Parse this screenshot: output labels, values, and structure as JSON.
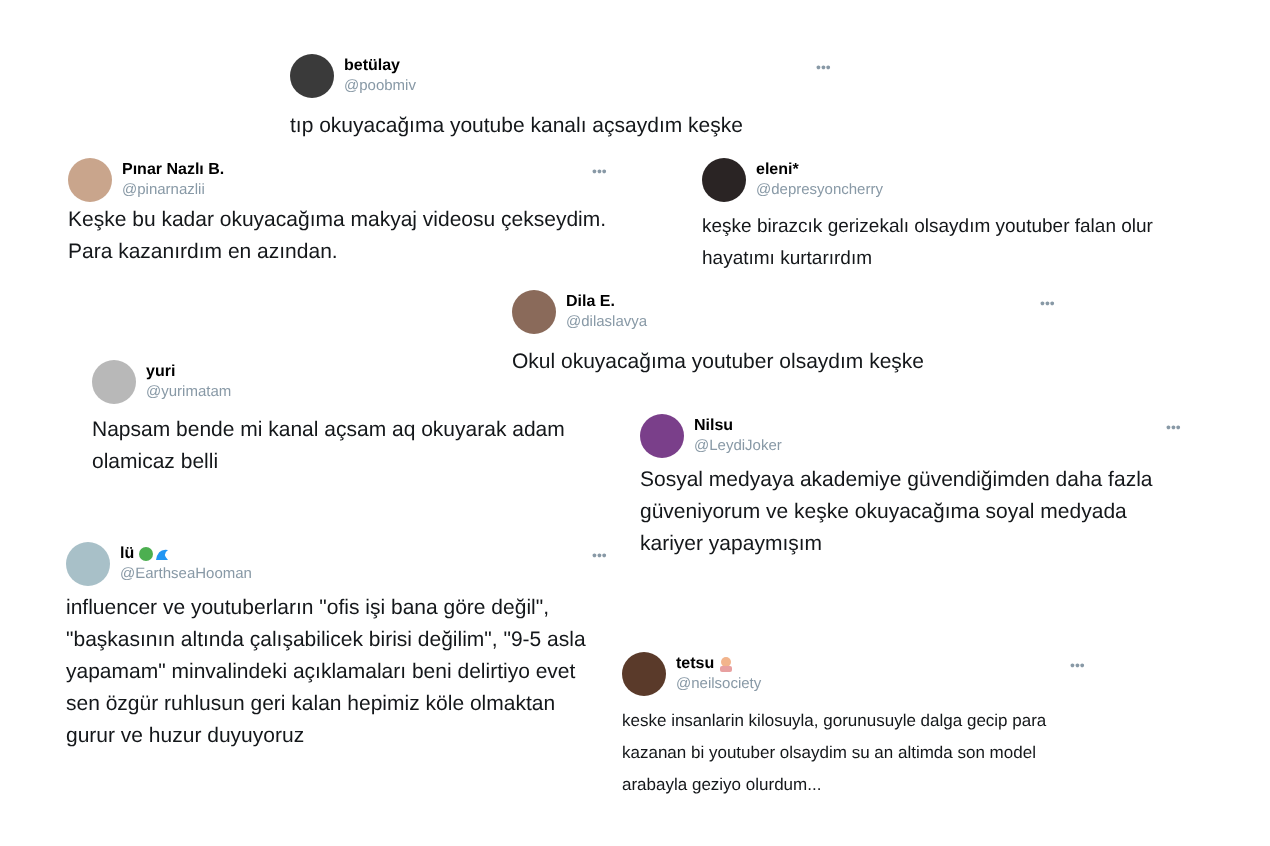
{
  "tweets": [
    {
      "name": "betülay",
      "handle": "@poobmiv",
      "text": "tıp okuyacağıma youtube kanalı açsaydım keşke",
      "menu": "•••",
      "emoji": false
    },
    {
      "name": "Pınar Nazlı B.",
      "handle": "@pinarnazlii",
      "text": "Keşke bu kadar okuyacağıma makyaj videosu çekseydim.\nPara kazanırdım en azından.",
      "menu": "•••",
      "emoji": false
    },
    {
      "name": "eleni*",
      "handle": "@depresyoncherry",
      "text": "keşke birazcık gerizekalı olsaydım youtuber falan olur\nhayatımı kurtarırdım",
      "emoji": false
    },
    {
      "name": "Dila E.",
      "handle": "@dilaslavya",
      "text": "Okul okuyacağıma youtuber olsaydım keşke",
      "menu": "•••",
      "emoji": false
    },
    {
      "name": "yuri",
      "handle": "@yurimatam",
      "text": "Napsam bende mi kanal açsam aq okuyarak adam\nolamicaz belli",
      "emoji": false
    },
    {
      "name": "Nilsu",
      "handle": "@LeydiJoker",
      "text": "Sosyal medyaya akademiye güvendiğimden daha fazla\ngüveniyorum ve keşke okuyacağıma soyal medyada\nkariyer yapaymışım",
      "menu": "•••",
      "emoji": false
    },
    {
      "name": "lü",
      "handle": "@EarthseaHooman",
      "text": "influencer ve youtuberların \"ofis işi bana göre değil\",\n\"başkasının altında çalışabilicek birisi değilim\", \"9-5 asla\nyapamam\" minvalindeki açıklamaları beni delirtiyo evet\nsen özgür ruhlusun geri kalan hepimiz köle olmaktan\ngurur ve huzur duyuyoruz",
      "menu": "•••",
      "emoji": true
    },
    {
      "name": "tetsu",
      "handle": "@neilsociety",
      "text": "keske insanlarin kilosuyla, gorunusuyle dalga gecip para\nkazanan bi youtuber olsaydim su an altimda son model\narabayla geziyo olurdum...",
      "menu": "•••",
      "emoji": true
    }
  ]
}
